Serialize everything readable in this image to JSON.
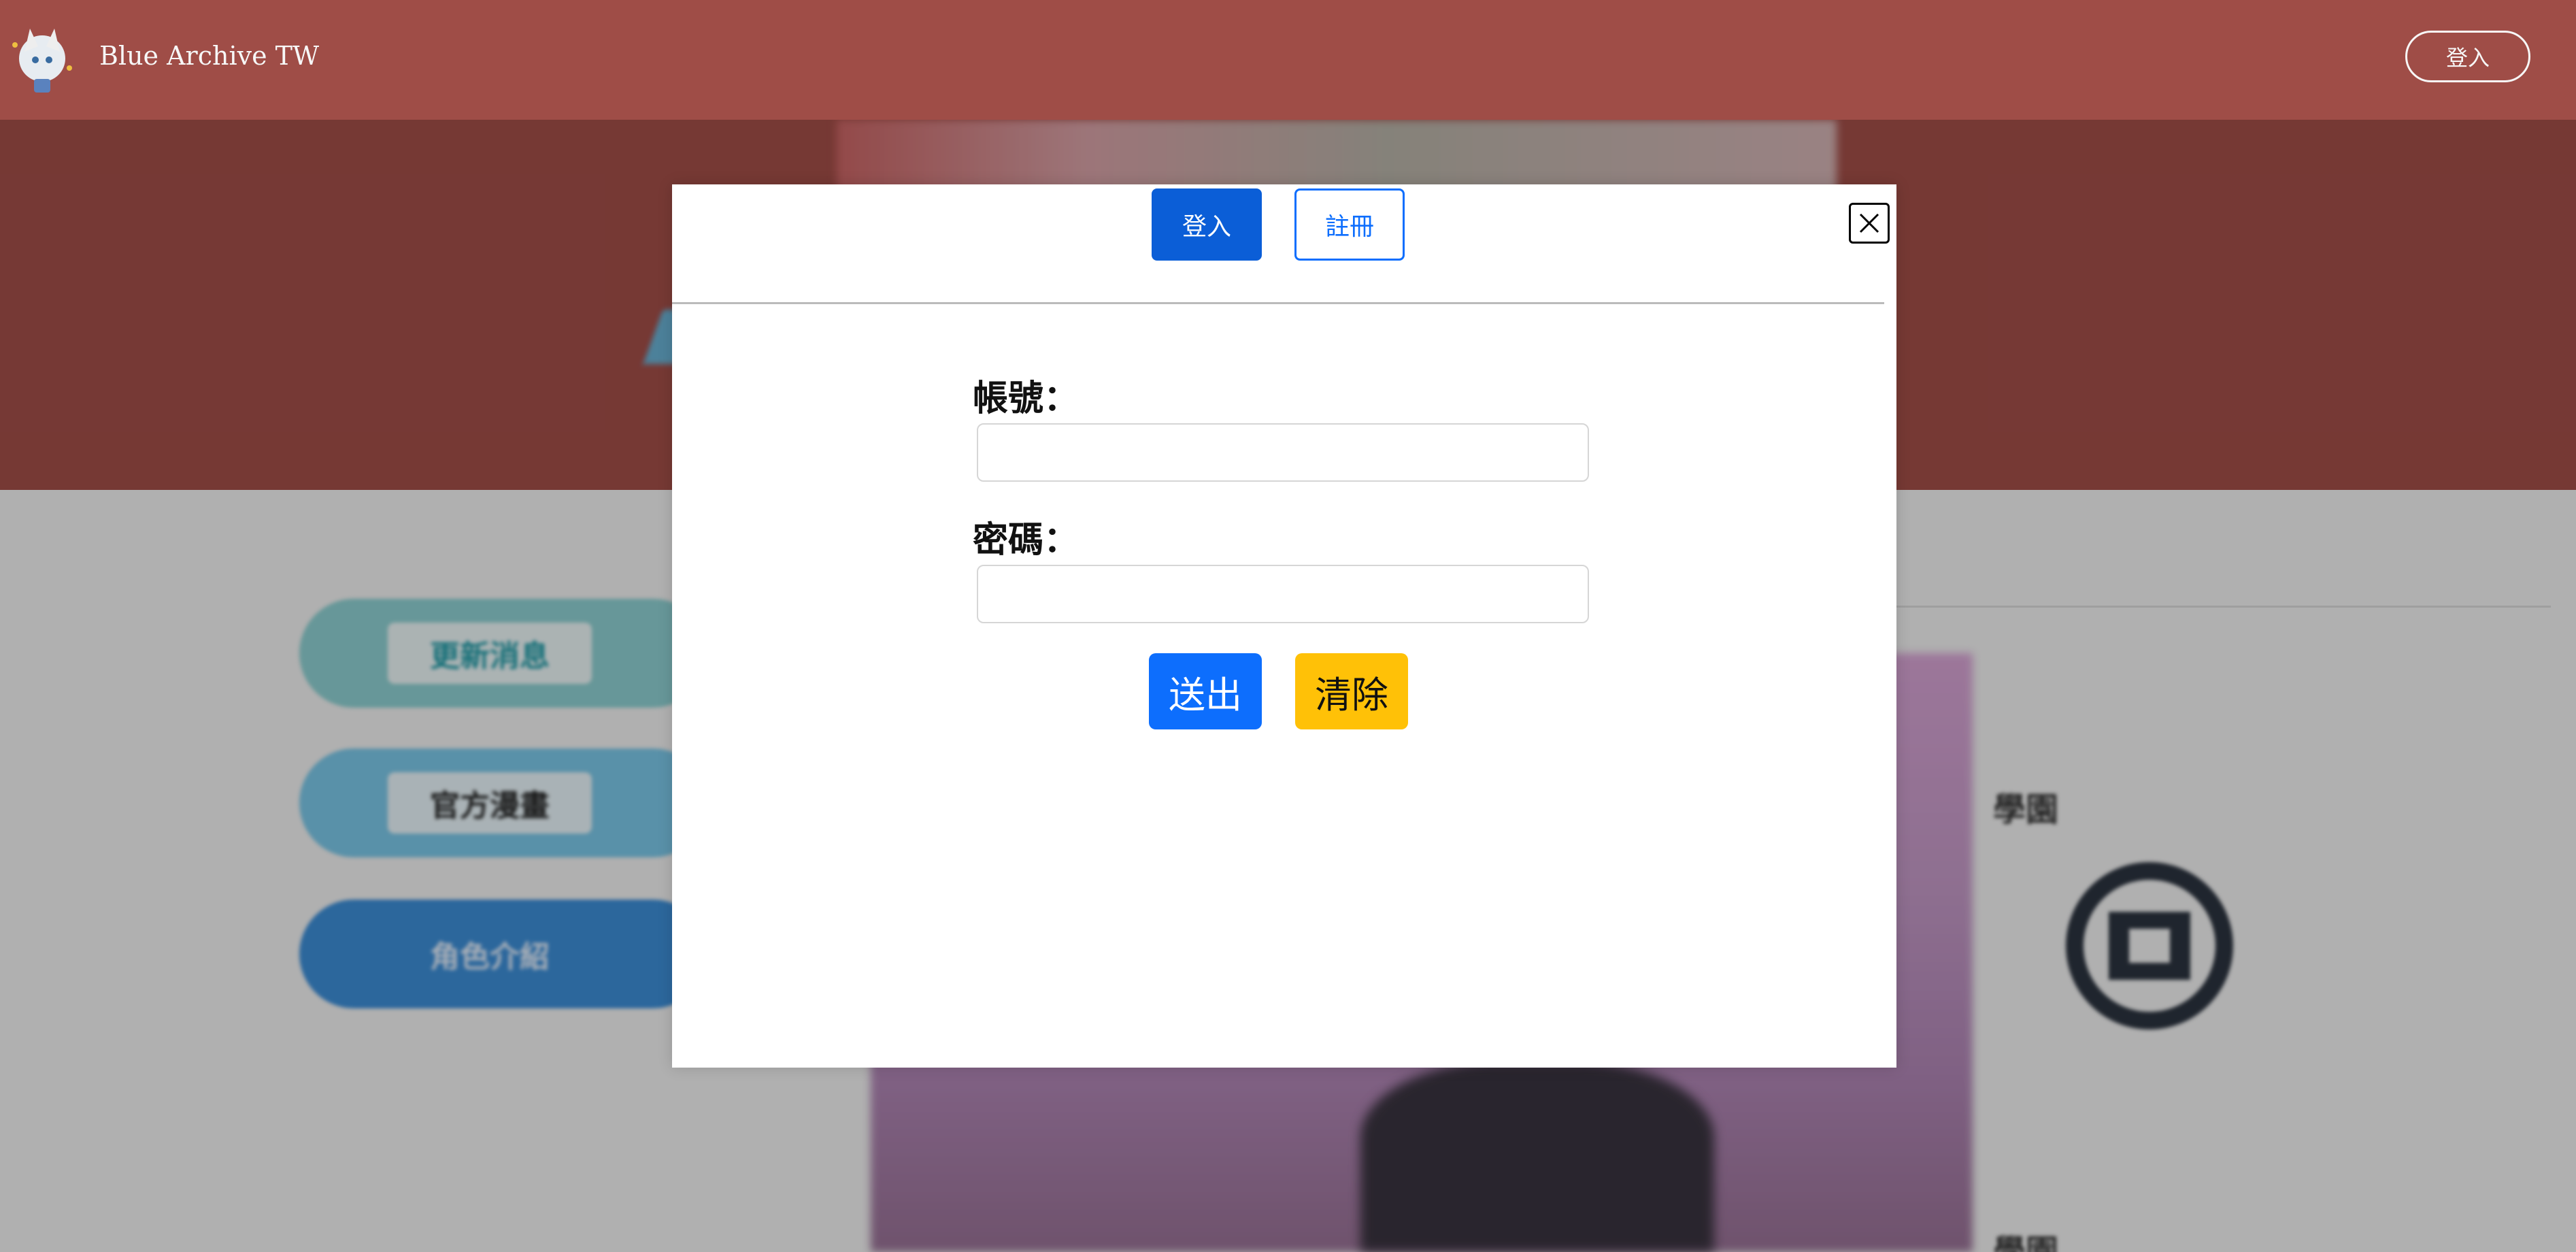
{
  "header": {
    "brand": "Blue Archive TW",
    "login_label": "登入",
    "logo_icon": "chibi-character-logo"
  },
  "background": {
    "side_buttons": [
      {
        "label": "更新消息",
        "color": "#8fd2d4"
      },
      {
        "label": "官方漫畫",
        "color": "#7cc9ea"
      },
      {
        "label": "角色介紹",
        "color": "#3d8fd9"
      }
    ],
    "school_label": "學園",
    "school_label_2": "學園"
  },
  "modal": {
    "tabs": {
      "login": "登入",
      "register": "註冊"
    },
    "close_icon": "close-x-icon",
    "fields": {
      "username_label": "帳號：",
      "username_value": "",
      "password_label": "密碼：",
      "password_value": ""
    },
    "buttons": {
      "submit": "送出",
      "clear": "清除"
    },
    "colors": {
      "primary": "#0d6efd",
      "warning": "#ffc107"
    }
  }
}
